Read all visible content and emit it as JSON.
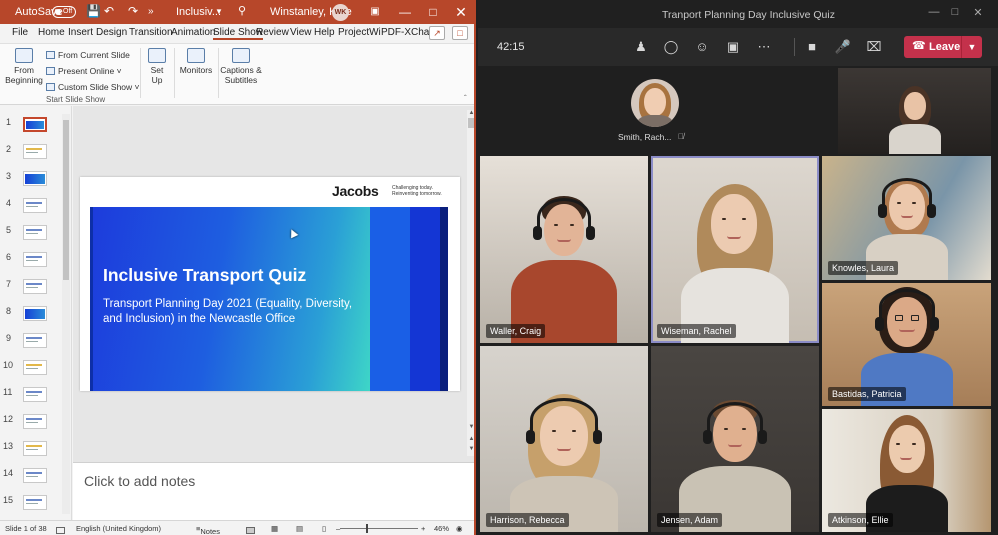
{
  "ppt": {
    "title_bar": {
      "autosave_label": "AutoSave",
      "autosave_state": "Off",
      "doc_name": "Inclusiv...",
      "user_name": "Winstanley, Kate",
      "user_initials": "WK"
    },
    "tabs": [
      "File",
      "Home",
      "Insert",
      "Design",
      "Transition",
      "Animation",
      "Slide Show",
      "Review",
      "View",
      "Help",
      "ProjectWi",
      "PDF-XCha"
    ],
    "active_tab": "Slide Show",
    "ribbon": {
      "from_beginning": "From Beginning",
      "from_current": "From Current Slide",
      "present_online": "Present Online",
      "custom_show": "Custom Slide Show",
      "group_start": "Start Slide Show",
      "set_up": "Set Up",
      "monitors": "Monitors",
      "captions": "Captions & Subtitles"
    },
    "thumbnails": [
      "1",
      "2",
      "3",
      "4",
      "5",
      "6",
      "7",
      "8",
      "9",
      "10",
      "11",
      "12",
      "13",
      "14",
      "15"
    ],
    "slide": {
      "logo": "Jacobs",
      "tagline_1": "Challenging today.",
      "tagline_2": "Reinventing tomorrow.",
      "title": "Inclusive Transport Quiz",
      "subtitle": "Transport Planning Day 2021 (Equality, Diversity, and Inclusion) in the Newcastle Office"
    },
    "notes_placeholder": "Click to add notes",
    "status": {
      "slide_count": "Slide 1 of 38",
      "language": "English (United Kingdom)",
      "notes": "Notes",
      "zoom": "46%"
    }
  },
  "teams": {
    "window_title": "Tranport Planning Day Inclusive Quiz",
    "timer": "42:15",
    "leave_label": "Leave",
    "participants": [
      {
        "name": "Smith, Rach..."
      },
      {
        "name": "Waller, Craig"
      },
      {
        "name": "Wiseman, Rachel"
      },
      {
        "name": "Knowles, Laura"
      },
      {
        "name": "Bastidas, Patricia"
      },
      {
        "name": "Harrison, Rebecca"
      },
      {
        "name": "Jensen, Adam"
      },
      {
        "name": "Atkinson, Ellie"
      }
    ],
    "colors": {
      "leave": "#c4314b",
      "active_speaker": "#8b8cc7",
      "ppt_accent": "#b7472a"
    }
  }
}
